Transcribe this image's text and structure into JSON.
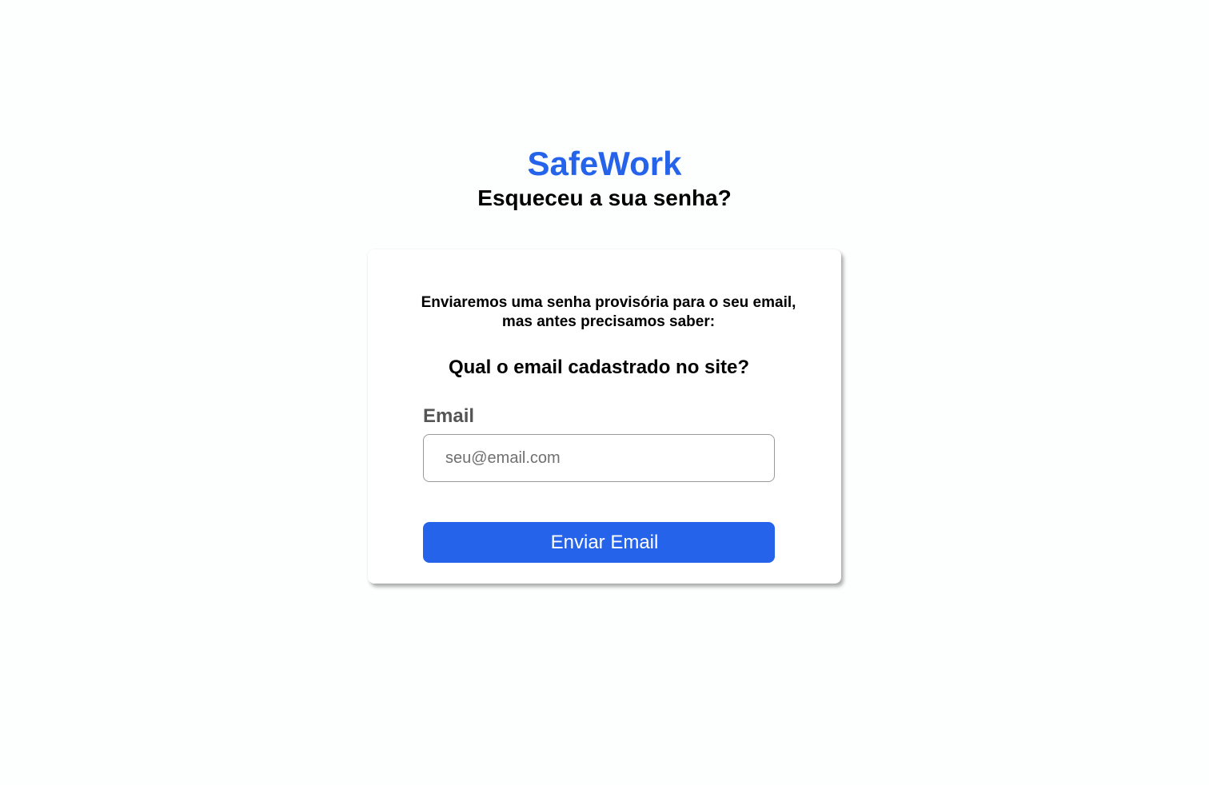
{
  "header": {
    "brand": "SafeWork",
    "title": "Esqueceu a sua senha?"
  },
  "card": {
    "intro": "Enviaremos uma senha provisória para o seu email, mas antes precisamos saber:",
    "question": "Qual o email cadastrado no site?",
    "email_label": "Email",
    "email_value": "",
    "email_placeholder": "seu@email.com",
    "submit_label": "Enviar Email"
  },
  "colors": {
    "brand": "#2563eb",
    "button_background": "#2563eb",
    "button_text": "#ffffff",
    "label_text": "#555555"
  }
}
